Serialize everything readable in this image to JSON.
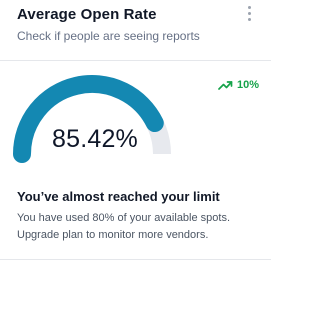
{
  "card": {
    "title": "Average Open Rate",
    "subtitle": "Check if people are seeing reports"
  },
  "menu": {
    "icon": "more-vertical-icon"
  },
  "trend": {
    "icon": "trending-up-icon",
    "value": "10%",
    "color": "#16a34a"
  },
  "gauge": {
    "value_text": "85.42%",
    "percent": 85.42,
    "fill_color": "#1488b2",
    "track_color": "#e7e9ee"
  },
  "alert": {
    "title": "You’ve almost reached your limit",
    "line1": "You have used 80% of your available spots.",
    "line2": "Upgrade plan to monitor more vendors."
  }
}
